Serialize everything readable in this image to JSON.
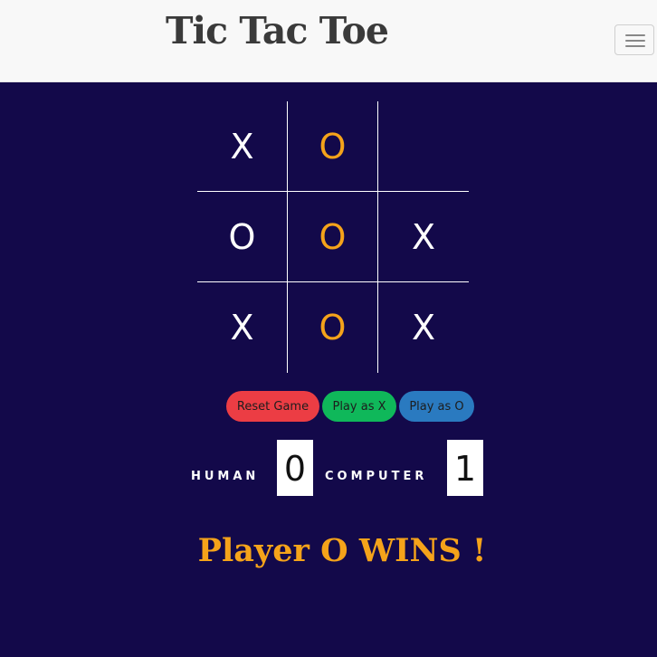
{
  "navbar": {
    "title": "Tic Tac Toe",
    "menu_icon": "hamburger-menu-icon"
  },
  "board": {
    "cells": [
      "X",
      "O",
      "",
      "O",
      "O",
      "X",
      "X",
      "O",
      "X"
    ]
  },
  "controls": {
    "reset_label": "Reset Game",
    "play_x_label": "Play as X",
    "play_o_label": "Play as O"
  },
  "score": {
    "human_label": "HUMAN",
    "human_value": "0",
    "computer_label": "COMPUTER",
    "computer_value": "1"
  },
  "status": {
    "message": "Player O WINS !"
  },
  "colors": {
    "background": "#13094a",
    "accent": "#f5a31a",
    "reset": "#ec3d44",
    "play_x": "#0fb85a",
    "play_o": "#2a7ac0"
  }
}
